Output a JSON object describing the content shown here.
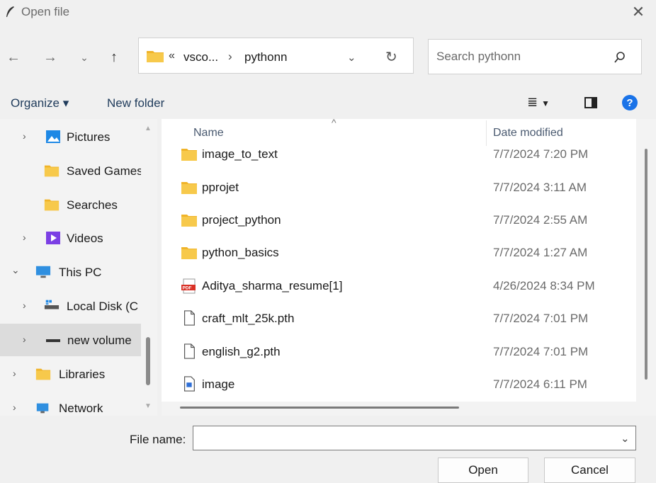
{
  "window": {
    "title": "Open file"
  },
  "address": {
    "overflow_glyph": "«",
    "crumbs": [
      "vsco...",
      "pythonn"
    ],
    "separator": "›"
  },
  "search": {
    "placeholder": "Search pythonn"
  },
  "toolbar": {
    "organize_label": "Organize ▾",
    "new_folder_label": "New folder"
  },
  "tree": [
    {
      "label": "Pictures",
      "icon": "pictures-icon",
      "expandable": true
    },
    {
      "label": "Saved Games",
      "icon": "folder-icon",
      "expandable": false
    },
    {
      "label": "Searches",
      "icon": "folder-icon",
      "expandable": false
    },
    {
      "label": "Videos",
      "icon": "videos-icon",
      "expandable": true
    },
    {
      "label": "This PC",
      "icon": "computer-icon",
      "expandable": true,
      "expanded": true
    },
    {
      "label": "Local Disk (C",
      "icon": "disk-icon",
      "expandable": true
    },
    {
      "label": "new volume",
      "icon": "drive-icon",
      "expandable": true,
      "selected": true
    },
    {
      "label": "Libraries",
      "icon": "libraries-icon",
      "expandable": true
    },
    {
      "label": "Network",
      "icon": "network-icon",
      "expandable": true
    }
  ],
  "columns": {
    "name": "Name",
    "date": "Date modified"
  },
  "files": [
    {
      "name": "image_to_text",
      "date": "7/7/2024 7:20 PM",
      "icon": "folder-icon"
    },
    {
      "name": "pprojet",
      "date": "7/7/2024 3:11 AM",
      "icon": "folder-icon"
    },
    {
      "name": "project_python",
      "date": "7/7/2024 2:55 AM",
      "icon": "folder-icon"
    },
    {
      "name": "python_basics",
      "date": "7/7/2024 1:27 AM",
      "icon": "folder-icon"
    },
    {
      "name": "Aditya_sharma_resume[1]",
      "date": "4/26/2024 8:34 PM",
      "icon": "pdf-icon"
    },
    {
      "name": "craft_mlt_25k.pth",
      "date": "7/7/2024 7:01 PM",
      "icon": "file-icon"
    },
    {
      "name": "english_g2.pth",
      "date": "7/7/2024 7:01 PM",
      "icon": "file-icon"
    },
    {
      "name": "image",
      "date": "7/7/2024 6:11 PM",
      "icon": "image-file-icon"
    }
  ],
  "bottom": {
    "file_name_label": "File name:",
    "file_name_value": "",
    "open_label": "Open",
    "cancel_label": "Cancel"
  },
  "colors": {
    "folder": "#f7c94b",
    "accent": "#0067c0",
    "help": "#1a73e8",
    "pdf": "#d93025"
  }
}
